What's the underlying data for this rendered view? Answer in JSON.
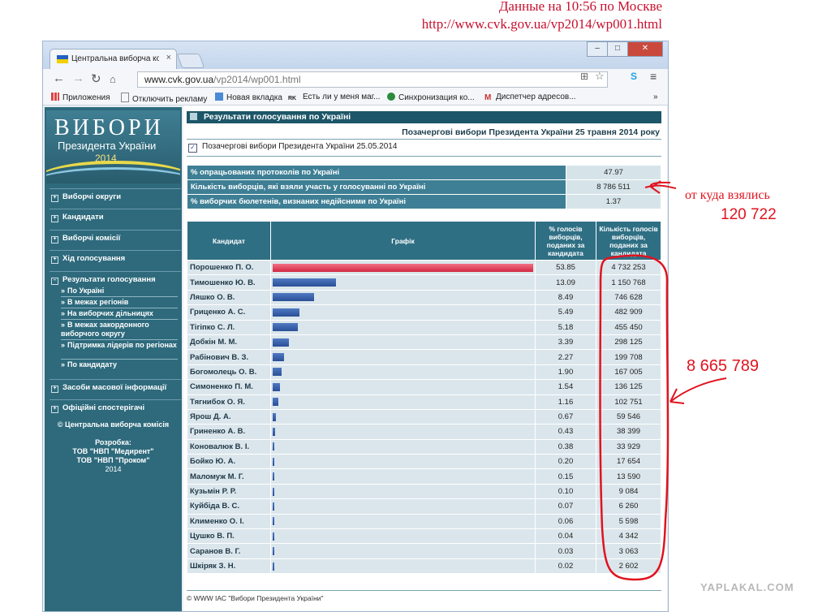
{
  "caption": {
    "line1": "Данные на 10:56 по Москве",
    "line2": "http://www.cvk.gov.ua/vp2014/wp001.html"
  },
  "browser": {
    "tab_title": "Центральна виборча ком",
    "tab_close": "×",
    "address_host": "www.cvk.gov.ua",
    "address_path": "/vp2014/wp001.html",
    "window_buttons": {
      "minimize": "–",
      "maximize": "□",
      "close": "✕"
    },
    "bookmarks": [
      {
        "label": "Приложения",
        "icon": "apps-grid-icon"
      },
      {
        "label": "Отключить рекламу",
        "icon": "page-icon"
      },
      {
        "label": "Новая вкладка",
        "icon": "new-tab-icon"
      },
      {
        "label": "Есть ли у меня маг...",
        "icon": "rk-icon"
      },
      {
        "label": "Синхронизация ко...",
        "icon": "sync-icon"
      },
      {
        "label": "Диспетчер адресов...",
        "icon": "gmail-icon"
      }
    ],
    "bookmarks_more": "»"
  },
  "logo": {
    "title": "ВИБОРИ",
    "subtitle": "Президента України",
    "year": "2014"
  },
  "sidebar": {
    "items": [
      {
        "label": "Виборчі округи",
        "marker": "+"
      },
      {
        "label": "Кандидати",
        "marker": "+"
      },
      {
        "label": "Виборчі комісії",
        "marker": "+"
      },
      {
        "label": "Хід голосування",
        "marker": "+"
      },
      {
        "label": "Результати голосування",
        "marker": "–"
      }
    ],
    "subitems": [
      "По Україні",
      "В межах регіонів",
      "На виборчих дільницях",
      "В межах закордонного виборчого округу",
      "Підтримка лідерів по регіонах",
      "По кандидату"
    ],
    "bottom_items": [
      {
        "label": "Засоби масової інформації",
        "marker": "+"
      },
      {
        "label": "Офіційні спостерігачі",
        "marker": "+"
      }
    ],
    "copyright": "© Центральна виборча комісія",
    "dev_label": "Розробка:",
    "dev_1": "ТОВ \"НВП \"Медирент\"",
    "dev_2": "ТОВ \"НВП \"Проком\"",
    "dev_year": "2014"
  },
  "main": {
    "section_title": "Результати голосування по Україні",
    "election_title": "Позачергові вибори Президента України 25 травня 2014 року",
    "checkbox_label": "Позачергові вибори Президента України 25.05.2014",
    "summary": [
      {
        "label": "% опрацьованих протоколів по Україні",
        "value": "47.97"
      },
      {
        "label": "Кількість виборців, які взяли участь у голосуванні по Україні",
        "value": "8 786 511"
      },
      {
        "label": "% виборчих бюлетенів, визнаних недійсними по Україні",
        "value": "1.37"
      }
    ],
    "headers": {
      "candidate": "Кандидат",
      "graph": "Графік",
      "percent": "% голосів виборців, поданих за кандидата",
      "votes": "Кількість голосів виборців, поданих за кандидата"
    },
    "rows": [
      {
        "name": "Порошенко П. О.",
        "percent": "53.85",
        "votes": "4 732 253",
        "pct": 53.85
      },
      {
        "name": "Тимошенко Ю. В.",
        "percent": "13.09",
        "votes": "1 150 768",
        "pct": 13.09
      },
      {
        "name": "Ляшко О. В.",
        "percent": "8.49",
        "votes": "746 628",
        "pct": 8.49
      },
      {
        "name": "Гриценко А. С.",
        "percent": "5.49",
        "votes": "482 909",
        "pct": 5.49
      },
      {
        "name": "Тігіпко С. Л.",
        "percent": "5.18",
        "votes": "455 450",
        "pct": 5.18
      },
      {
        "name": "Добкін М. М.",
        "percent": "3.39",
        "votes": "298 125",
        "pct": 3.39
      },
      {
        "name": "Рабінович В. З.",
        "percent": "2.27",
        "votes": "199 708",
        "pct": 2.27
      },
      {
        "name": "Богомолець О. В.",
        "percent": "1.90",
        "votes": "167 005",
        "pct": 1.9
      },
      {
        "name": "Симоненко П. М.",
        "percent": "1.54",
        "votes": "136 125",
        "pct": 1.54
      },
      {
        "name": "Тягнибок О. Я.",
        "percent": "1.16",
        "votes": "102 751",
        "pct": 1.16
      },
      {
        "name": "Ярош Д. А.",
        "percent": "0.67",
        "votes": "59 546",
        "pct": 0.67
      },
      {
        "name": "Гриненко А. В.",
        "percent": "0.43",
        "votes": "38 399",
        "pct": 0.43
      },
      {
        "name": "Коновалюк В. І.",
        "percent": "0.38",
        "votes": "33 929",
        "pct": 0.38
      },
      {
        "name": "Бойко Ю. А.",
        "percent": "0.20",
        "votes": "17 654",
        "pct": 0.2
      },
      {
        "name": "Маломуж М. Г.",
        "percent": "0.15",
        "votes": "13 590",
        "pct": 0.15
      },
      {
        "name": "Кузьмін Р. Р.",
        "percent": "0.10",
        "votes": "9 084",
        "pct": 0.1
      },
      {
        "name": "Куйбіда В. С.",
        "percent": "0.07",
        "votes": "6 260",
        "pct": 0.07
      },
      {
        "name": "Клименко О. І.",
        "percent": "0.06",
        "votes": "5 598",
        "pct": 0.06
      },
      {
        "name": "Цушко В. П.",
        "percent": "0.04",
        "votes": "4 342",
        "pct": 0.04
      },
      {
        "name": "Саранов В. Г.",
        "percent": "0.03",
        "votes": "3 063",
        "pct": 0.03
      },
      {
        "name": "Шкіряк З. Н.",
        "percent": "0.02",
        "votes": "2 602",
        "pct": 0.02
      }
    ],
    "footer": "© WWW ІАС \"Вибори Президента України\""
  },
  "annotations": {
    "question": "от куда взялись",
    "question_value": "120 722",
    "sum": "8 665 789",
    "color": "#e0131f"
  },
  "watermark": "YAPLAKAL.COM"
}
